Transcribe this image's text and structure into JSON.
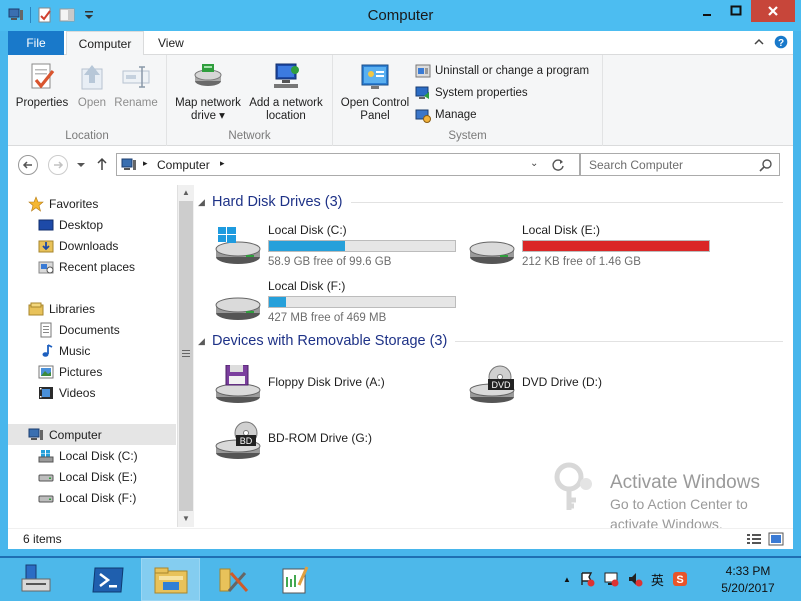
{
  "window": {
    "title": "Computer"
  },
  "ribbon": {
    "tabs": {
      "file": "File",
      "computer": "Computer",
      "view": "View"
    },
    "location": {
      "caption": "Location",
      "properties": "Properties",
      "open": "Open",
      "rename": "Rename"
    },
    "network": {
      "caption": "Network",
      "map_line1": "Map network",
      "map_line2": "drive",
      "add_line1": "Add a network",
      "add_line2": "location"
    },
    "system": {
      "caption": "System",
      "open_cp_line1": "Open Control",
      "open_cp_line2": "Panel",
      "uninstall": "Uninstall or change a program",
      "system_properties": "System properties",
      "manage": "Manage"
    }
  },
  "address": {
    "path_item": "Computer",
    "search_placeholder": "Search Computer"
  },
  "nav": {
    "favorites": "Favorites",
    "desktop": "Desktop",
    "downloads": "Downloads",
    "recent": "Recent places",
    "libraries": "Libraries",
    "documents": "Documents",
    "music": "Music",
    "pictures": "Pictures",
    "videos": "Videos",
    "computer": "Computer",
    "drive_c": "Local Disk (C:)",
    "drive_e": "Local Disk (E:)",
    "drive_f": "Local Disk (F:)"
  },
  "content": {
    "hdd_header": "Hard Disk Drives (3)",
    "removable_header": "Devices with Removable Storage (3)",
    "drives": [
      {
        "name": "Local Disk (C:)",
        "free": "58.9 GB free of 99.6 GB",
        "used_fraction": 0.41,
        "color": "#26a0da"
      },
      {
        "name": "Local Disk (E:)",
        "free": "212 KB free of 1.46 GB",
        "used_fraction": 1.0,
        "color": "#da2626"
      },
      {
        "name": "Local Disk (F:)",
        "free": "427 MB free of 469 MB",
        "used_fraction": 0.09,
        "color": "#26a0da"
      }
    ],
    "devices": {
      "floppy": "Floppy Disk Drive (A:)",
      "dvd": "DVD Drive (D:)",
      "bd": "BD-ROM Drive (G:)",
      "dvd_badge": "DVD",
      "bd_badge": "BD"
    }
  },
  "status": {
    "items": "6 items"
  },
  "watermark": {
    "line1": "Activate Windows",
    "line2": "Go to Action Center to",
    "line3": "activate Windows."
  },
  "taskbar": {
    "time": "4:33 PM",
    "date": "5/20/2017",
    "ime": "英"
  }
}
